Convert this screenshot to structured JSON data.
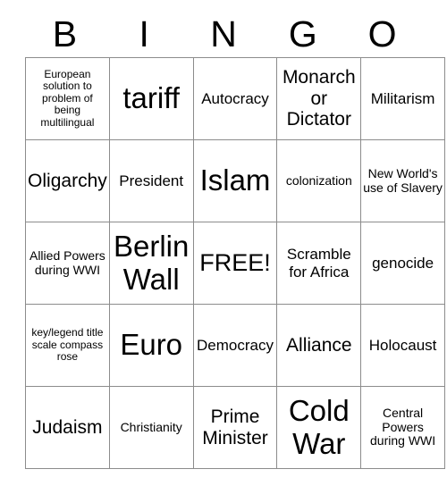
{
  "card": {
    "header_letters": [
      "B",
      "I",
      "N",
      "G",
      "O"
    ],
    "rows": [
      [
        {
          "text": "European solution to problem of being multilingual",
          "size": "fs-xs"
        },
        {
          "text": "tariff",
          "size": "fs-xxl"
        },
        {
          "text": "Autocracy",
          "size": "fs-md"
        },
        {
          "text": "Monarch or Dictator",
          "size": "fs-lg"
        },
        {
          "text": "Militarism",
          "size": "fs-md"
        }
      ],
      [
        {
          "text": "Oligarchy",
          "size": "fs-lg"
        },
        {
          "text": "President",
          "size": "fs-md"
        },
        {
          "text": "Islam",
          "size": "fs-xxl"
        },
        {
          "text": "colonization",
          "size": "fs-sm"
        },
        {
          "text": "New World's use of Slavery",
          "size": "fs-sm"
        }
      ],
      [
        {
          "text": "Allied Powers during WWI",
          "size": "fs-sm"
        },
        {
          "text": "Berlin Wall",
          "size": "fs-xxl"
        },
        {
          "text": "FREE!",
          "size": "fs-xl"
        },
        {
          "text": "Scramble for Africa",
          "size": "fs-md"
        },
        {
          "text": "genocide",
          "size": "fs-md"
        }
      ],
      [
        {
          "text": "key/legend title scale compass rose",
          "size": "fs-xs"
        },
        {
          "text": "Euro",
          "size": "fs-xxl"
        },
        {
          "text": "Democracy",
          "size": "fs-md"
        },
        {
          "text": "Alliance",
          "size": "fs-lg"
        },
        {
          "text": "Holocaust",
          "size": "fs-md"
        }
      ],
      [
        {
          "text": "Judaism",
          "size": "fs-lg"
        },
        {
          "text": "Christianity",
          "size": "fs-sm"
        },
        {
          "text": "Prime Minister",
          "size": "fs-lg"
        },
        {
          "text": "Cold War",
          "size": "fs-xxl"
        },
        {
          "text": "Central Powers during WWI",
          "size": "fs-sm"
        }
      ]
    ],
    "colors": {
      "border": "#8c8c8c",
      "cell_background": "#ffffff",
      "text": "#000000"
    }
  }
}
